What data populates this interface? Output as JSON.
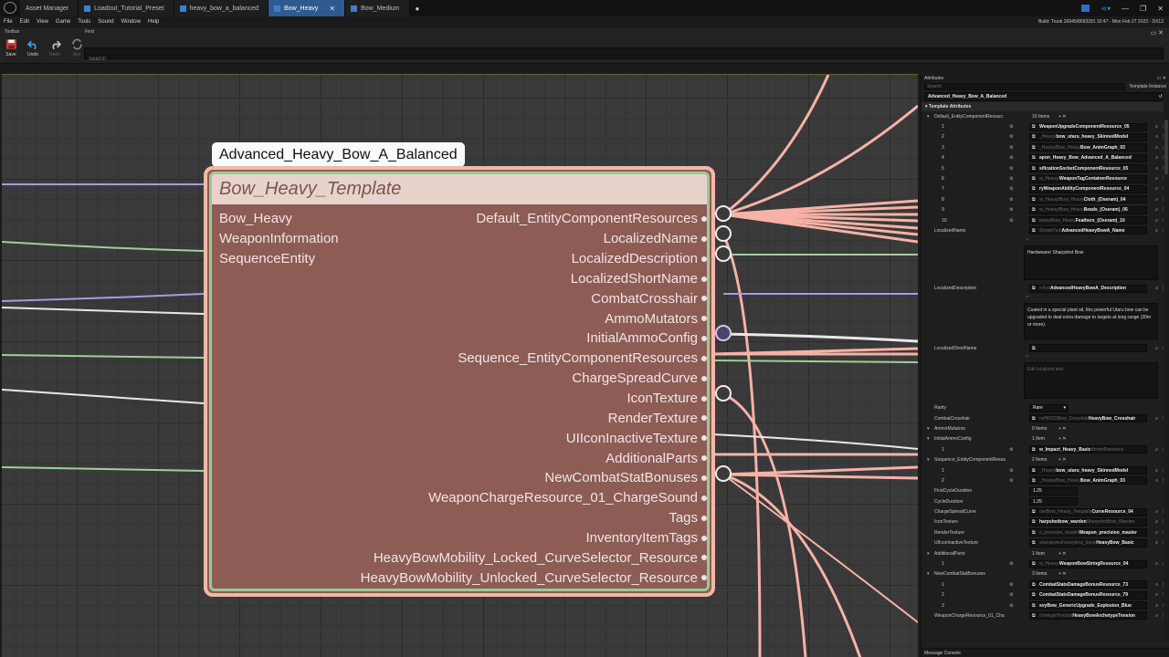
{
  "tabs": [
    {
      "label": "Asset Manager",
      "active": false
    },
    {
      "label": "Loadout_Tutorial_Preset",
      "active": false
    },
    {
      "label": "heavy_bow_a_balanced",
      "active": false
    },
    {
      "label": "Bow_Heavy",
      "active": true
    },
    {
      "label": "Bow_Medium",
      "active": false
    }
  ],
  "menu": [
    "File",
    "Edit",
    "View",
    "Game",
    "Tools",
    "Sound",
    "Window",
    "Help"
  ],
  "build_info": "Build: Trunk 26945/8693281 10:47 - Mon Feb 27 2023 - DX12",
  "toolbar": {
    "panel_label": "Toolbar",
    "find_label": "Find",
    "save": "Save",
    "undo": "Undo",
    "redo": "Redo",
    "sync": "Syn",
    "search_placeholder": "Search"
  },
  "graph": {
    "instance_title": "Advanced_Heavy_Bow_A_Balanced",
    "node_title": "Bow_Heavy_Template",
    "inputs": [
      "Bow_Heavy",
      "WeaponInformation",
      "SequenceEntity"
    ],
    "outputs": [
      "Default_EntityComponentResources",
      "LocalizedName",
      "LocalizedDescription",
      "LocalizedShortName",
      "CombatCrosshair",
      "AmmoMutators",
      "InitialAmmoConfig",
      "Sequence_EntityComponentResources",
      "ChargeSpreadCurve",
      "IconTexture",
      "RenderTexture",
      "UIIconInactiveTexture",
      "AdditionalParts",
      "NewCombatStatBonuses",
      "WeaponChargeResource_01_ChargeSound",
      "Tags",
      "InventoryItemTags",
      "HeavyBowMobility_Locked_CurveSelector_Resource",
      "HeavyBowMobility_Unlocked_CurveSelector_Resource"
    ]
  },
  "attributes": {
    "panel_title": "Attributes",
    "search_placeholder": "Search",
    "template_instance": "Template Instance",
    "object_name": "Advanced_Heavy_Bow_A_Balanced",
    "section": "Template Attributes",
    "default_ecr": {
      "label": "Default_EntityComponentResourc",
      "count": "10 Items",
      "items": [
        {
          "idx": "1",
          "dim": "",
          "val": "WeaponUpgradeComponentResource_05"
        },
        {
          "idx": "2",
          "dim": "_Heavy/",
          "val": "bow_utaru_heavy_SkinnedModel"
        },
        {
          "idx": "3",
          "dim": "_Heavy/Bow_Heavy",
          "val": "Bow_AnimGraph_03"
        },
        {
          "idx": "4",
          "dim": "",
          "val": "apon_Heavy_Bow_Advanced_A_Balanced"
        },
        {
          "idx": "5",
          "dim": "",
          "val": "sificationSocketComponentResource_05"
        },
        {
          "idx": "6",
          "dim": "w_Heavy/",
          "val": "WeaponTagContainerResource"
        },
        {
          "idx": "7",
          "dim": "",
          "val": "ryWeaponAbilityComponentResource_04"
        },
        {
          "idx": "8",
          "dim": "w_Heavy/Bow_Heavy",
          "val": "Cloth_(Oseram)_04"
        },
        {
          "idx": "9",
          "dim": "w_Heavy/Bow_Heavy",
          "val": "Beads_(Oseram)_05"
        },
        {
          "idx": "10",
          "dim": "leavy/Bow_Heavy",
          "val": "Feathers_(Oseram)_10"
        }
      ]
    },
    "localized_name": {
      "label": "LocalizedName",
      "dim": "SimpleText",
      "val": "AdvancedHeavyBowA_Name",
      "text": "Hardwearer Sharpshot Bow"
    },
    "localized_description": {
      "label": "LocalizedDescription",
      "dim": "eText",
      "val": "AdvancedHeavyBowA_Description",
      "text": "Coated in a special plant oil, this powerful Utaru bow can be upgraded to deal extra damage to targets at long range (30m or more)."
    },
    "localized_short_name": {
      "label": "LocalizedShortName",
      "placeholder": "Edit localized text..."
    },
    "rarity": {
      "label": "Rarity",
      "val": "Rare"
    },
    "combat_crosshair": {
      "label": "CombatCrosshair",
      "dim": "rs/HRZ2/Bow_Crosshair",
      "val": "HeavyBow_Crosshair"
    },
    "ammo_mutators": {
      "label": "AmmoMutators",
      "count": "0 Items"
    },
    "initial_ammo": {
      "label": "InitialAmmoConfig",
      "count": "1 Item",
      "items": [
        {
          "idx": "1",
          "dim": "",
          "val": "w_Impact_Heavy_Basic",
          "tail": "AmmoResource"
        }
      ]
    },
    "sequence_ecr": {
      "label": "Sequence_EntityComponentResou",
      "count": "2 Items",
      "items": [
        {
          "idx": "1",
          "dim": "_Heavy/",
          "val": "bow_utaru_heavy_SkinnedModel"
        },
        {
          "idx": "2",
          "dim": "_Heavy/Bow_Heavy",
          "val": "Bow_AnimGraph_03"
        }
      ]
    },
    "first_cycle": {
      "label": "FirstCycleDuration",
      "val": "1.25"
    },
    "cycle": {
      "label": "CycleDuration",
      "val": "1.25"
    },
    "charge_spread": {
      "label": "ChargeSpreadCurve",
      "dim": "ow/Bow_Heavy_Template",
      "val": "CurveResource_04"
    },
    "icon_texture": {
      "label": "IconTexture",
      "dim": "",
      "val": "harpshotbow_warden",
      "tail": "SharpshotBow_Warden"
    },
    "render_texture": {
      "label": "RenderTexture",
      "dim": "s_precision_master",
      "val": "Weapon_precision_master"
    },
    "ui_icon_inactive": {
      "label": "UIIconInactiveTexture",
      "dim": "s/weapons/heavybow_basic",
      "val": "HeavyBow_Basic"
    },
    "additional_parts": {
      "label": "AdditionalParts",
      "count": "1 Item",
      "items": [
        {
          "idx": "1",
          "dim": "w_Heavy/",
          "val": "WeaponBowStringResource_04"
        }
      ]
    },
    "new_combat_stat": {
      "label": "NewCombatStatBonuses",
      "count": "3 Items",
      "items": [
        {
          "idx": "1",
          "dim": "",
          "val": "CombatStatsDamageBonusResource_73"
        },
        {
          "idx": "2",
          "dim": "",
          "val": "CombatStatsDamageBonusResource_79"
        },
        {
          "idx": "3",
          "dim": "",
          "val": "svyBow_GenericUpgrade_Explosion_Blue"
        }
      ]
    },
    "weapon_charge": {
      "label": "WeaponChargeResource_01_Cha",
      "dim": "rchetypeTension",
      "val": "HeavyBowArchetypeTension"
    },
    "message_console": "Message Console"
  }
}
